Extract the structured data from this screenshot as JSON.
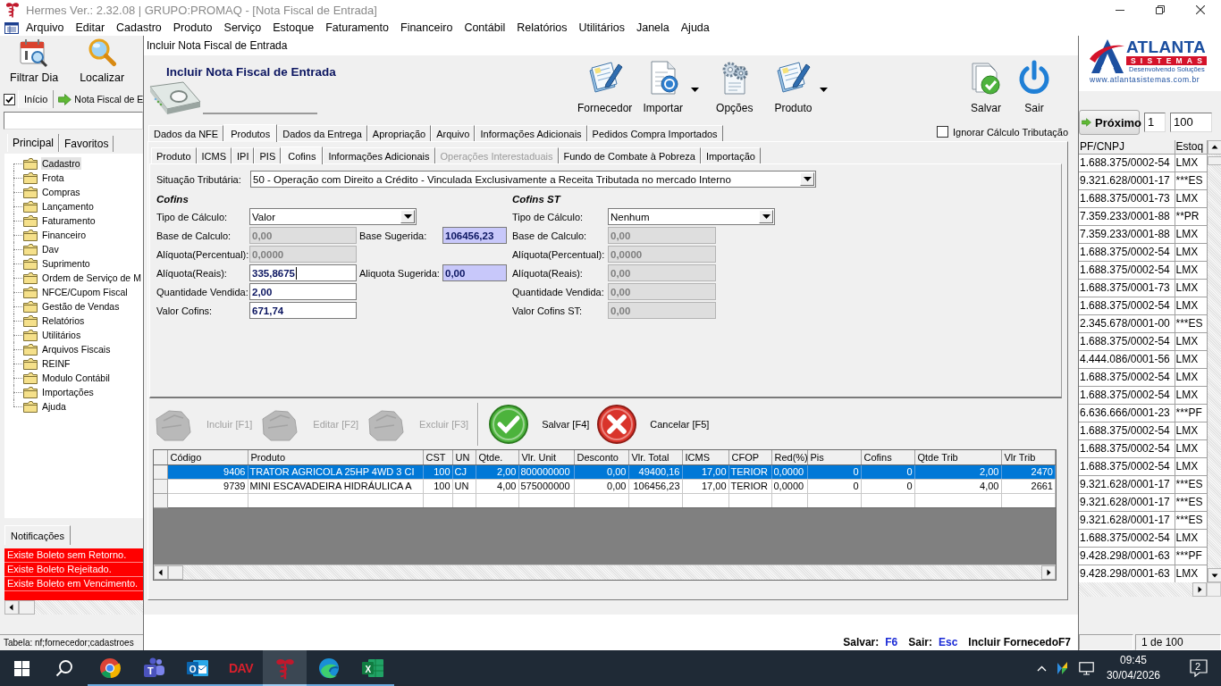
{
  "window": {
    "title": "Hermes Ver.: 2.32.08 | GRUPO:PROMAQ - [Nota Fiscal de Entrada]"
  },
  "menu": [
    "Arquivo",
    "Editar",
    "Cadastro",
    "Produto",
    "Serviço",
    "Estoque",
    "Faturamento",
    "Financeiro",
    "Contábil",
    "Relatórios",
    "Utilitários",
    "Janela",
    "Ajuda"
  ],
  "left_panel": {
    "toolbar": [
      {
        "kind": "calendar",
        "label": "Filtrar Dia"
      },
      {
        "kind": "search",
        "label": "Localizar"
      }
    ],
    "open_windows": {
      "checked": true,
      "tabs": [
        {
          "label": "Início",
          "selected": false
        },
        {
          "label": "Nota Fiscal de E",
          "selected": true
        }
      ]
    },
    "nav_tabs": [
      {
        "label": "Principal",
        "selected": true
      },
      {
        "label": "Favoritos",
        "selected": false
      }
    ],
    "tree": [
      {
        "label": "Cadastro",
        "selected": true
      },
      {
        "label": "Frota",
        "selected": false
      },
      {
        "label": "Compras",
        "selected": false
      },
      {
        "label": "Lançamento",
        "selected": false
      },
      {
        "label": "Faturamento",
        "selected": false
      },
      {
        "label": "Financeiro",
        "selected": false
      },
      {
        "label": "Dav",
        "selected": false
      },
      {
        "label": "Suprimento",
        "selected": false
      },
      {
        "label": "Ordem de Serviço de M",
        "selected": false
      },
      {
        "label": "NFCE/Cupom Fiscal",
        "selected": false
      },
      {
        "label": "Gestão de Vendas",
        "selected": false
      },
      {
        "label": "Relatórios",
        "selected": false
      },
      {
        "label": "Utilitários",
        "selected": false
      },
      {
        "label": "Arquivos Fiscais",
        "selected": false
      },
      {
        "label": "REINF",
        "selected": false
      },
      {
        "label": "Modulo Contábil",
        "selected": false
      },
      {
        "label": "Importações",
        "selected": false
      },
      {
        "label": "Ajuda",
        "selected": false
      }
    ],
    "notifications": {
      "title": "Notificações",
      "items": [
        "Existe Boleto sem Retorno.",
        "Existe Boleto Rejeitado.",
        "Existe Boleto em Vencimento."
      ]
    },
    "status": "Tabela: nf;fornecedor;cadastroes"
  },
  "dialog": {
    "title": "Incluir Nota Fiscal de Entrada",
    "heading": "Incluir Nota Fiscal de Entrada",
    "toolbar": [
      {
        "kind": "supplier",
        "label": "Fornecedor",
        "dropdown": false
      },
      {
        "kind": "import",
        "label": "Importar",
        "dropdown": true
      },
      {
        "kind": "options",
        "label": "Opções",
        "dropdown": false
      },
      {
        "kind": "product",
        "label": "Produto",
        "dropdown": true
      }
    ],
    "toolbar_right": [
      {
        "kind": "save",
        "label": "Salvar",
        "dropdown": false
      },
      {
        "kind": "exit",
        "label": "Sair",
        "dropdown": false
      }
    ],
    "tabs": [
      {
        "label": "Dados da NFE",
        "selected": false
      },
      {
        "label": "Produtos",
        "selected": true
      },
      {
        "label": "Dados da Entrega",
        "selected": false
      },
      {
        "label": "Apropriação",
        "selected": false
      },
      {
        "label": "Arquivo",
        "selected": false
      },
      {
        "label": "Informações Adicionais",
        "selected": false
      },
      {
        "label": "Pedidos Compra Importados",
        "selected": false
      }
    ],
    "ignore_tax_calc": {
      "label": "Ignorar Cálculo Tributação",
      "checked": false
    },
    "subtabs": [
      {
        "label": "Produto",
        "selected": false,
        "disabled": false
      },
      {
        "label": "ICMS",
        "selected": false,
        "disabled": false
      },
      {
        "label": "IPI",
        "selected": false,
        "disabled": false
      },
      {
        "label": "PIS",
        "selected": false,
        "disabled": false
      },
      {
        "label": "Cofins",
        "selected": true,
        "disabled": false
      },
      {
        "label": "Informações Adicionais",
        "selected": false,
        "disabled": false
      },
      {
        "label": "Operações Interestaduais",
        "selected": false,
        "disabled": true
      },
      {
        "label": "Fundo de Combate à Pobreza",
        "selected": false,
        "disabled": false
      },
      {
        "label": "Importação",
        "selected": false,
        "disabled": false
      }
    ],
    "tax_situation": {
      "label": "Situação Tributária:",
      "value": "50 - Operação com Direito a Crédito - Vinculada Exclusivamente a Receita Tributada no mercado Interno"
    },
    "cofins": {
      "title": "Cofins",
      "fields": [
        {
          "label": "Tipo de Cálculo:",
          "kind": "select",
          "value": "Valor",
          "disabled": false
        },
        {
          "label": "Base de Calculo:",
          "kind": "input",
          "value": "0,00",
          "disabled": true,
          "focused": false,
          "suggestion": {
            "label": "Base Sugerida:",
            "value": "106456,23"
          }
        },
        {
          "label": "Alíquota(Percentual):",
          "kind": "input",
          "value": "0,0000",
          "disabled": true,
          "focused": false
        },
        {
          "label": "Alíquota(Reais):",
          "kind": "input",
          "value": "335,8675",
          "disabled": false,
          "focused": true,
          "suggestion": {
            "label": "Aliquota Sugerida:",
            "value": "0,00"
          }
        },
        {
          "label": "Quantidade Vendida:",
          "kind": "input",
          "value": "2,00",
          "disabled": false,
          "focused": false
        },
        {
          "label": "Valor Cofins:",
          "kind": "input",
          "value": "671,74",
          "disabled": false,
          "focused": false
        }
      ]
    },
    "cofins_st": {
      "title": "Cofins ST",
      "fields": [
        {
          "label": "Tipo de Cálculo:",
          "kind": "select",
          "value": "Nenhum",
          "disabled": false
        },
        {
          "label": "Base de Calculo:",
          "kind": "input",
          "value": "0,00",
          "disabled": true,
          "focused": false
        },
        {
          "label": "Alíquota(Percentual):",
          "kind": "input",
          "value": "0,0000",
          "disabled": true,
          "focused": false
        },
        {
          "label": "Alíquota(Reais):",
          "kind": "input",
          "value": "0,00",
          "disabled": true,
          "focused": false
        },
        {
          "label": "Quantidade Vendida:",
          "kind": "input",
          "value": "0,00",
          "disabled": true,
          "focused": false
        },
        {
          "label": "Valor Cofins ST:",
          "kind": "input",
          "value": "0,00",
          "disabled": true,
          "focused": false
        }
      ]
    },
    "actions": [
      {
        "kind": "add",
        "label": "Incluir [F1]",
        "disabled": true
      },
      {
        "kind": "edit",
        "label": "Editar [F2]",
        "disabled": true
      },
      {
        "kind": "delete",
        "label": "Excluir [F3]",
        "disabled": true
      },
      {
        "kind": "save",
        "label": "Salvar [F4]",
        "disabled": false
      },
      {
        "kind": "cancel",
        "label": "Cancelar [F5]",
        "disabled": false
      }
    ],
    "grid": {
      "columns": [
        "Código",
        "Produto",
        "CST",
        "UN",
        "Qtde.",
        "Vlr. Unit",
        "Desconto",
        "Vlr. Total",
        "ICMS",
        "CFOP",
        "Red(%)",
        "Pis",
        "Cofins",
        "Qtde Trib",
        "Vlr Trib"
      ],
      "rows": [
        {
          "selected": true,
          "cells": [
            "9406",
            "TRATOR AGRICOLA 25HP 4WD 3 CI",
            "100",
            "CJ",
            "2,00",
            "800000000",
            "0,00",
            "49400,16",
            "17,00",
            "TERIOR",
            "0,0000",
            "0",
            "0",
            "2,00",
            "2470"
          ]
        },
        {
          "selected": false,
          "cells": [
            "9739",
            "MINI ESCAVADEIRA HIDRÁULICA A",
            "100",
            "UN",
            "4,00",
            "575000000",
            "0,00",
            "106456,23",
            "17,00",
            "TERIOR",
            "0,0000",
            "0",
            "0",
            "4,00",
            "2661"
          ]
        }
      ]
    },
    "shortcuts": [
      {
        "label": "Salvar:",
        "key": "F6"
      },
      {
        "label": "Sair:",
        "key": "Esc"
      },
      {
        "label": "Incluir FornecedoF7"
      }
    ]
  },
  "right_panel": {
    "logo": {
      "name": "ATLANTA",
      "band": "SISTEMAS",
      "slogan": "Desenvolvendo Soluções",
      "url": "www.atlantasistemas.com.br"
    },
    "next_button": "Próximo",
    "range_start": "1",
    "range_size": "100",
    "table": {
      "columns": [
        "PF/CNPJ",
        "Estoq"
      ],
      "rows": [
        [
          "1.688.375/0002-54",
          "LMX"
        ],
        [
          "9.321.628/0001-17",
          "***ES"
        ],
        [
          "1.688.375/0001-73",
          "LMX"
        ],
        [
          "7.359.233/0001-88",
          "**PR"
        ],
        [
          "7.359.233/0001-88",
          "LMX"
        ],
        [
          "1.688.375/0002-54",
          "LMX"
        ],
        [
          "1.688.375/0002-54",
          "LMX"
        ],
        [
          "1.688.375/0001-73",
          "LMX"
        ],
        [
          "1.688.375/0002-54",
          "LMX"
        ],
        [
          "2.345.678/0001-00",
          "***ES"
        ],
        [
          "1.688.375/0002-54",
          "LMX"
        ],
        [
          "4.444.086/0001-56",
          "LMX"
        ],
        [
          "1.688.375/0002-54",
          "LMX"
        ],
        [
          "1.688.375/0002-54",
          "LMX"
        ],
        [
          "6.636.666/0001-23",
          "***PF"
        ],
        [
          "1.688.375/0002-54",
          "LMX"
        ],
        [
          "1.688.375/0002-54",
          "LMX"
        ],
        [
          "1.688.375/0002-54",
          "LMX"
        ],
        [
          "9.321.628/0001-17",
          "***ES"
        ],
        [
          "9.321.628/0001-17",
          "***ES"
        ],
        [
          "9.321.628/0001-17",
          "***ES"
        ],
        [
          "1.688.375/0002-54",
          "LMX"
        ],
        [
          "9.428.298/0001-63",
          "***PF"
        ],
        [
          "9.428.298/0001-63",
          "LMX"
        ]
      ]
    },
    "status": "1 de 100"
  },
  "taskbar": {
    "apps": [
      {
        "kind": "browser",
        "running": true,
        "selected": false
      },
      {
        "kind": "chat",
        "glyph": "T",
        "running": true,
        "selected": false
      },
      {
        "kind": "mail",
        "glyph": "O",
        "running": true,
        "selected": false
      },
      {
        "kind": "dav",
        "glyph": "DAV",
        "running": true,
        "selected": false
      },
      {
        "kind": "emblem",
        "running": true,
        "selected": true
      },
      {
        "kind": "wave",
        "running": true,
        "selected": false
      },
      {
        "kind": "sheet",
        "glyph": "X",
        "running": true,
        "selected": false
      }
    ],
    "time": "09:45",
    "date": "30/04/2026",
    "notification_count": "2"
  }
}
